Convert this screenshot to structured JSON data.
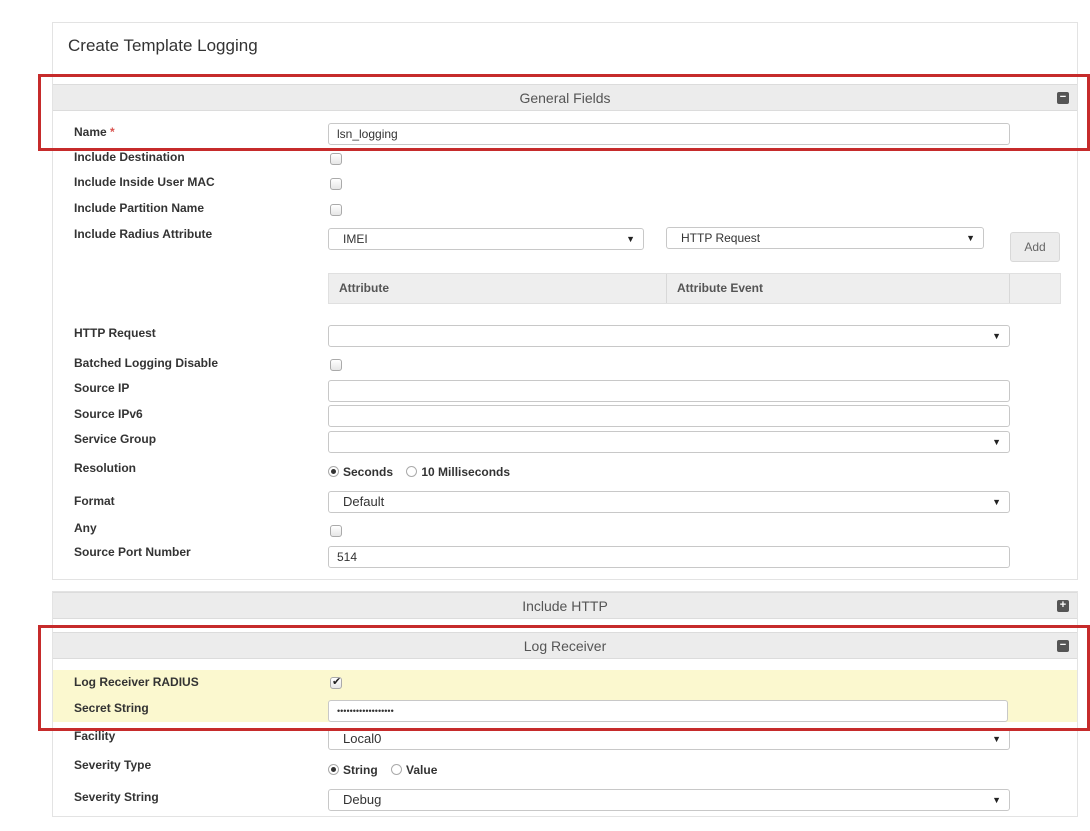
{
  "page_title": "Create Template Logging",
  "general_section": {
    "title": "General Fields",
    "toggle": "−",
    "name": {
      "label": "Name",
      "required_mark": "*",
      "value": "lsn_logging"
    },
    "include_destination": {
      "label": "Include Destination",
      "checked": false
    },
    "include_inside_user_mac": {
      "label": "Include Inside User MAC",
      "checked": false
    },
    "include_partition_name": {
      "label": "Include Partition Name",
      "checked": false
    },
    "include_radius_attribute": {
      "label": "Include Radius Attribute",
      "attribute_select": "IMEI",
      "event_select": "HTTP Request",
      "add_button": "Add"
    },
    "attribute_table": {
      "headers": [
        "Attribute",
        "Attribute Event"
      ]
    },
    "http_request": {
      "label": "HTTP Request",
      "value": ""
    },
    "batched_logging_disable": {
      "label": "Batched Logging Disable",
      "checked": false
    },
    "source_ip": {
      "label": "Source IP",
      "value": ""
    },
    "source_ipv6": {
      "label": "Source IPv6",
      "value": ""
    },
    "service_group": {
      "label": "Service Group",
      "value": ""
    },
    "resolution": {
      "label": "Resolution",
      "options": [
        "Seconds",
        "10 Milliseconds"
      ],
      "selected": "Seconds"
    },
    "format": {
      "label": "Format",
      "value": "Default"
    },
    "any": {
      "label": "Any",
      "checked": false
    },
    "source_port_number": {
      "label": "Source Port Number",
      "value": "514"
    }
  },
  "include_http_section": {
    "title": "Include HTTP",
    "toggle": "+"
  },
  "log_receiver_section": {
    "title": "Log Receiver",
    "toggle": "−",
    "log_receiver_radius": {
      "label": "Log Receiver RADIUS",
      "checked": true
    },
    "secret_string": {
      "label": "Secret String",
      "value": "••••••••••••••••••"
    },
    "facility": {
      "label": "Facility",
      "value": "Local0"
    },
    "severity_type": {
      "label": "Severity Type",
      "options": [
        "String",
        "Value"
      ],
      "selected": "String"
    },
    "severity_string": {
      "label": "Severity String",
      "value": "Debug"
    }
  },
  "colors": {
    "highlight_row": "#fbf8cf",
    "annotation_frame": "#c62b2b",
    "section_header": "#ececec"
  }
}
